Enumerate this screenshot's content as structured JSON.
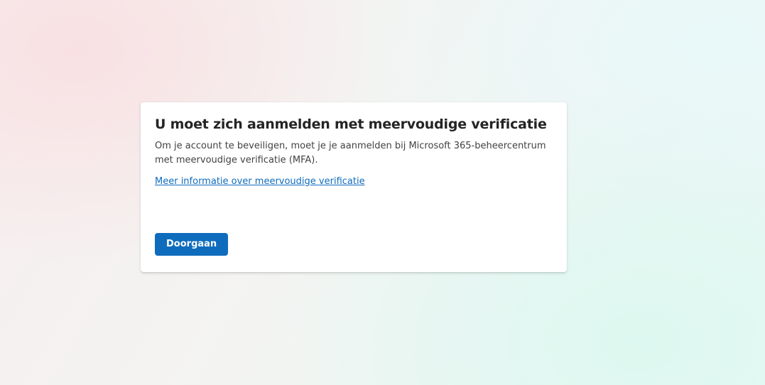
{
  "theme": {
    "accent": "#0f6cbd",
    "title_color": "#242424",
    "text_color": "#424242",
    "card_background": "#ffffff"
  },
  "dialog": {
    "title": "U moet zich aanmelden met meervoudige verificatie",
    "description": "Om je account te beveiligen, moet je je aanmelden bij Microsoft 365-beheercentrum met meervoudige verificatie (MFA).",
    "learn_more_link": "Meer informatie over meervoudige verificatie",
    "continue_button": "Doorgaan"
  }
}
